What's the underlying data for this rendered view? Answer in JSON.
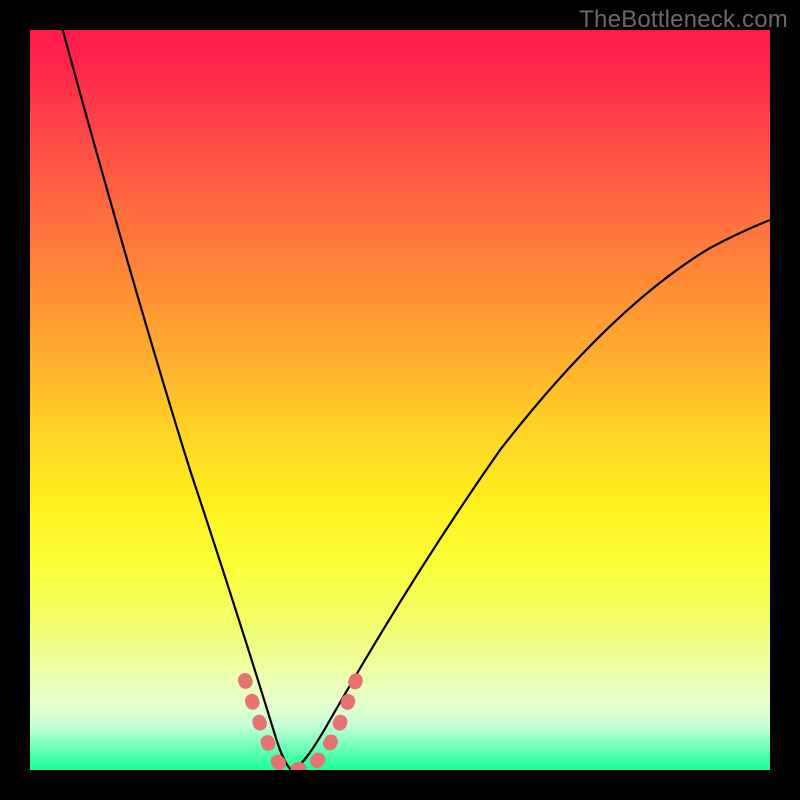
{
  "watermark": "TheBottleneck.com",
  "colors": {
    "curve_black": "#000000",
    "highlight_pink": "#e6736f",
    "gradient_top": "#ff1a4d",
    "gradient_bottom": "#1aff99",
    "frame_black": "#000000"
  },
  "chart_data": {
    "type": "line",
    "title": "",
    "xlabel": "",
    "ylabel": "",
    "xlim": [
      0,
      100
    ],
    "ylim": [
      0,
      100
    ],
    "grid": false,
    "legend": false,
    "note": "No axes or tick labels are rendered in the image; x and y values are estimated from pixel positions on a 0–100 normalized scale. Lower y = bottom of plot (green). Two curves form a V shape meeting near x≈34, y≈0.",
    "series": [
      {
        "name": "left-curve",
        "x": [
          4,
          8,
          12,
          16,
          20,
          24,
          28,
          30,
          32,
          34
        ],
        "y": [
          100,
          80,
          62,
          46,
          32,
          20,
          10,
          5,
          2,
          0
        ]
      },
      {
        "name": "right-curve",
        "x": [
          34,
          38,
          42,
          48,
          56,
          64,
          72,
          80,
          88,
          96,
          100
        ],
        "y": [
          0,
          4,
          10,
          20,
          32,
          44,
          54,
          62,
          68,
          73,
          75
        ]
      },
      {
        "name": "highlight-segment",
        "x": [
          28,
          30,
          32,
          34,
          36,
          38,
          40,
          42
        ],
        "y": [
          12,
          6,
          2,
          0,
          0,
          2,
          6,
          12
        ],
        "style": "thick-pink-dotted"
      }
    ]
  }
}
